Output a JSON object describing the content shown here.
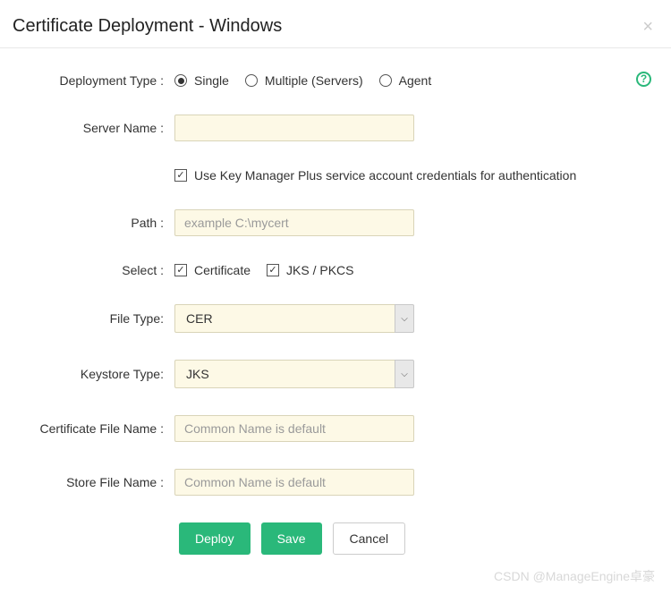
{
  "header": {
    "title": "Certificate Deployment - Windows"
  },
  "help_icon_glyph": "?",
  "labels": {
    "deployment_type": "Deployment Type :",
    "server_name": "Server Name :",
    "path": "Path :",
    "select": "Select :",
    "file_type": "File Type:",
    "keystore_type": "Keystore Type:",
    "certificate_file_name": "Certificate File Name :",
    "store_file_name": "Store File Name :"
  },
  "deployment_type": {
    "options": {
      "single": "Single",
      "multiple": "Multiple (Servers)",
      "agent": "Agent"
    },
    "selected": "single"
  },
  "server_name": {
    "value": ""
  },
  "credentials_checkbox": {
    "label": "Use Key Manager Plus service account credentials for authentication",
    "checked": true
  },
  "path": {
    "placeholder": "example C:\\mycert",
    "value": ""
  },
  "select_options": {
    "certificate": {
      "label": "Certificate",
      "checked": true
    },
    "jks_pkcs": {
      "label": "JKS / PKCS",
      "checked": true
    }
  },
  "file_type": {
    "value": "CER"
  },
  "keystore_type": {
    "value": "JKS"
  },
  "certificate_file_name": {
    "placeholder": "Common Name is default",
    "value": ""
  },
  "store_file_name": {
    "placeholder": "Common Name is default",
    "value": ""
  },
  "buttons": {
    "deploy": "Deploy",
    "save": "Save",
    "cancel": "Cancel"
  },
  "watermark": "CSDN @ManageEngine卓豪"
}
